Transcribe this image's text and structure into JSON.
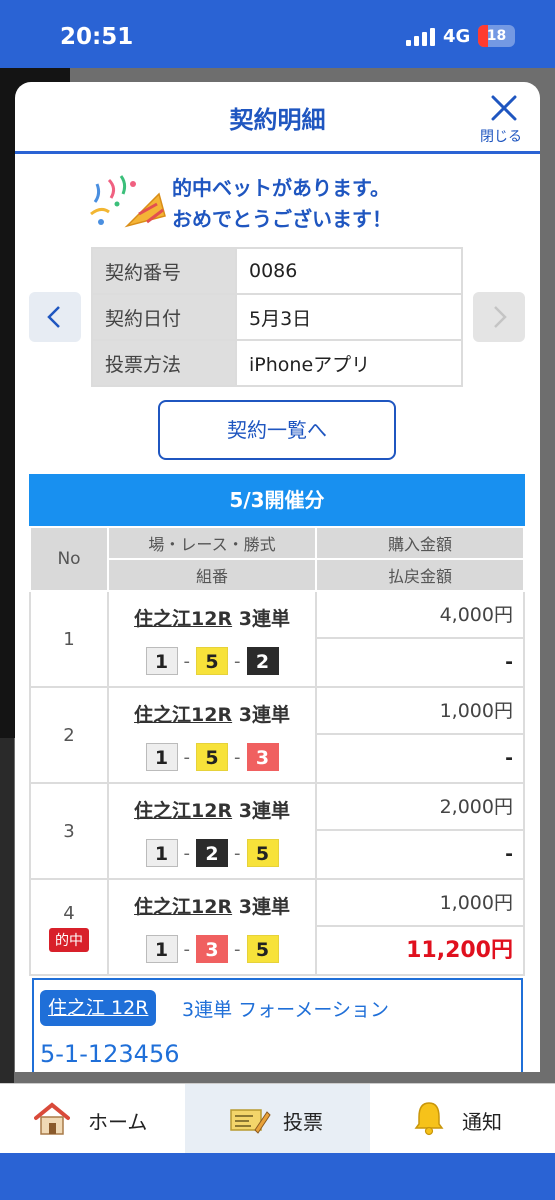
{
  "status_bar": {
    "time": "20:51",
    "network": "4G",
    "battery": "18"
  },
  "modal": {
    "title": "契約明細",
    "close_label": "閉じる"
  },
  "congrats": {
    "line1": "的中ベットがあります。",
    "line2": "おめでとうございます！"
  },
  "contract_info": [
    {
      "label": "契約番号",
      "value": "0086"
    },
    {
      "label": "契約日付",
      "value": "5月3日"
    },
    {
      "label": "投票方法",
      "value": "iPhoneアプリ"
    }
  ],
  "list_button": "契約一覧へ",
  "session": "5/3開催分",
  "table_headers": {
    "no": "No",
    "race": "場・レース・勝式",
    "combo": "組番",
    "purchase": "購入金額",
    "payout": "払戻金額"
  },
  "bets": [
    {
      "no": "1",
      "place": "住之江12R",
      "type": "3連単",
      "combo": [
        "1",
        "5",
        "2"
      ],
      "sep": "-",
      "purchase": "4,000円",
      "payout": "-",
      "badge": ""
    },
    {
      "no": "2",
      "place": "住之江12R",
      "type": "3連単",
      "combo": [
        "1",
        "5",
        "3"
      ],
      "sep": "-",
      "purchase": "1,000円",
      "payout": "-",
      "badge": ""
    },
    {
      "no": "3",
      "place": "住之江12R",
      "type": "3連単",
      "combo": [
        "1",
        "2",
        "5"
      ],
      "sep": "-",
      "purchase": "2,000円",
      "payout": "-",
      "badge": ""
    },
    {
      "no": "4",
      "place": "住之江12R",
      "type": "3連単",
      "combo": [
        "1",
        "3",
        "5"
      ],
      "sep": "-",
      "purchase": "1,000円",
      "payout": "11,200円",
      "badge": "的中"
    }
  ],
  "formation": {
    "race": "住之江 12R",
    "type": "3連単 フォーメーション",
    "numbers": "5-1-123456"
  },
  "bottom_nav": [
    {
      "label": "ホーム",
      "icon": "home-icon"
    },
    {
      "label": "投票",
      "icon": "ticket-icon"
    },
    {
      "label": "通知",
      "icon": "bell-icon"
    }
  ],
  "colors": {
    "primary": "#1f56c0",
    "session_bar": "#1890f0",
    "win_red": "#e0101e",
    "box_1": "#eeeeee",
    "box_2": "#2b2b2b",
    "box_3": "#f06060",
    "box_5": "#f7e23a"
  }
}
